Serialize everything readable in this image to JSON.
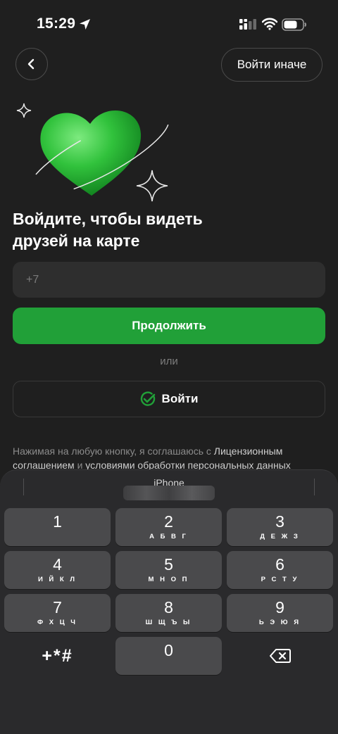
{
  "status_bar": {
    "time": "15:29"
  },
  "header": {
    "other_login_label": "Войти иначе"
  },
  "headline": {
    "line1": "Войдите, чтобы видеть",
    "line2": "друзей на карте"
  },
  "phone_input": {
    "placeholder": "+7",
    "value": ""
  },
  "buttons": {
    "continue_label": "Продолжить",
    "or_text": "или",
    "sber_login_label": "Войти"
  },
  "legal": {
    "part1": "Нажимая на любую кнопку, я соглашаюсь с ",
    "link1": "Лицензионным соглашением",
    "part2": " и ",
    "link2": "условиями обработки персональных данных"
  },
  "keyboard": {
    "title": "iPhone",
    "keys": [
      {
        "digit": "1",
        "letters": ""
      },
      {
        "digit": "2",
        "letters": "А Б В Г"
      },
      {
        "digit": "3",
        "letters": "Д Е Ж З"
      },
      {
        "digit": "4",
        "letters": "И Й К Л"
      },
      {
        "digit": "5",
        "letters": "М Н О П"
      },
      {
        "digit": "6",
        "letters": "Р С Т У"
      },
      {
        "digit": "7",
        "letters": "Ф Х Ц Ч"
      },
      {
        "digit": "8",
        "letters": "Ш Щ Ъ Ы"
      },
      {
        "digit": "9",
        "letters": "Ь Э Ю Я"
      },
      {
        "digit": "0",
        "letters": ""
      }
    ],
    "symbols_label": "+*#"
  },
  "colors": {
    "accent_green": "#21a038",
    "background": "#1f1f1f",
    "keyboard_bg": "#2a2a2c",
    "key_bg": "#4a4a4c"
  }
}
